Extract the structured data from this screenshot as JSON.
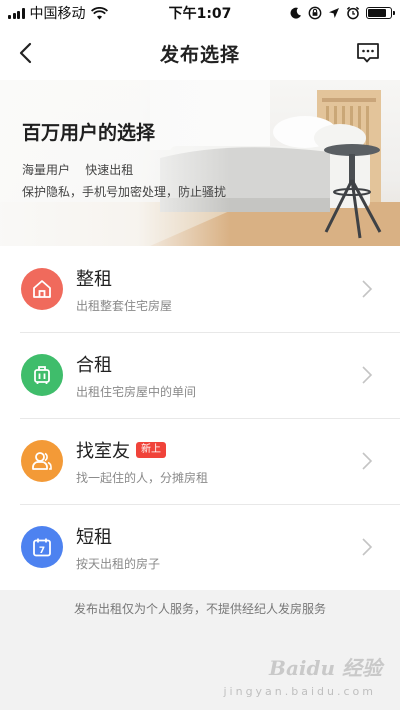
{
  "status_bar": {
    "carrier": "中国移动",
    "time": "下午1:07",
    "battery_level": 0.8,
    "icons": [
      "signal-icon",
      "wifi-icon",
      "moon-icon",
      "lock-rotation-icon",
      "location-arrow-icon",
      "alarm-icon",
      "battery-icon"
    ]
  },
  "nav": {
    "title": "发布选择",
    "back_icon": "chevron-left-icon",
    "message_icon": "message-bubble-icon"
  },
  "banner": {
    "title": "百万用户的选择",
    "line1": "海量用户    快速出租",
    "line2": "保护隐私，手机号加密处理，防止骚扰"
  },
  "options": [
    {
      "title": "整租",
      "desc": "出租整套住宅房屋",
      "icon": "house-icon",
      "color": "#f06a5c",
      "badge": ""
    },
    {
      "title": "合租",
      "desc": "出租住宅房屋中的单间",
      "icon": "luggage-icon",
      "color": "#3fbd6b",
      "badge": ""
    },
    {
      "title": "找室友",
      "desc": "找一起住的人，分摊房租",
      "icon": "users-icon",
      "color": "#f39a37",
      "badge": "新上"
    },
    {
      "title": "短租",
      "desc": "按天出租的房子",
      "icon": "calendar-icon",
      "color": "#4d82f0",
      "badge": ""
    }
  ],
  "calendar_day": "7",
  "footer_note": "发布出租仅为个人服务，不提供经纪人发房服务",
  "watermark": {
    "logo": "Baidu 经验",
    "sub": "jingyan.baidu.com"
  }
}
